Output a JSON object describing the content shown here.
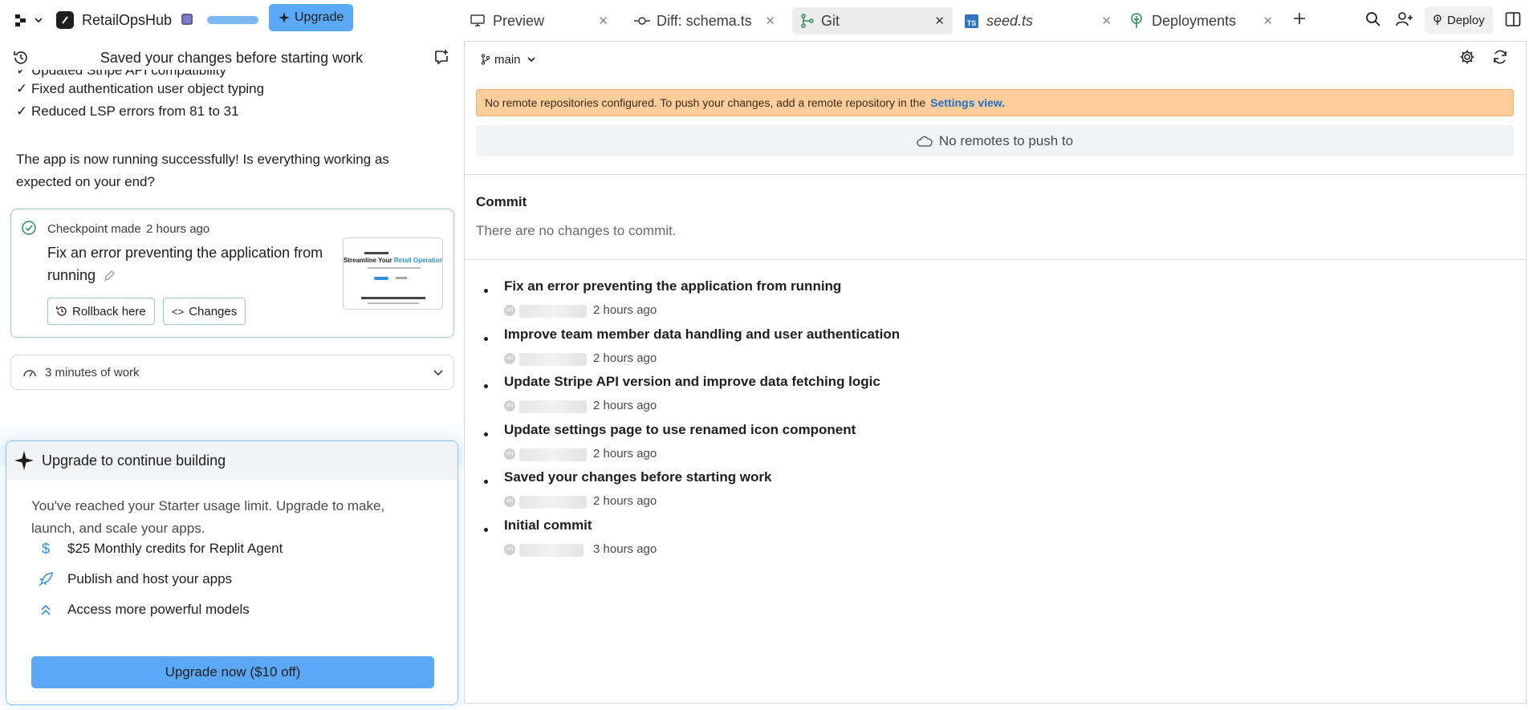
{
  "topbar": {
    "project_name": "RetailOpsHub",
    "upgrade_label": "Upgrade",
    "tabs": [
      {
        "label": "Preview"
      },
      {
        "label": "Diff: schema.ts"
      },
      {
        "label": "Git"
      },
      {
        "label": "seed.ts",
        "badge": "TS"
      },
      {
        "label": "Deployments"
      }
    ],
    "deploy_label": "Deploy"
  },
  "chat": {
    "header_title": "Saved your changes before starting work",
    "partial_line": "✓ Updated Stripe API compatibility",
    "lines": [
      "✓ Fixed authentication user object typing",
      "✓ Reduced LSP errors from 81 to 31"
    ],
    "message": "The app is now running successfully! Is everything working as expected on your end?",
    "checkpoint": {
      "label": "Checkpoint made",
      "time": "2 hours ago",
      "title": "Fix an error preventing the application from running",
      "rollback_label": "Rollback here",
      "changes_label": "Changes",
      "thumb_line1": "Streamline Your",
      "thumb_line2": "Retail Operations"
    },
    "work_label": "3 minutes of work"
  },
  "upgrade_card": {
    "title": "Upgrade to continue building",
    "description": "You've reached your Starter usage limit. Upgrade to make, launch, and scale your apps.",
    "features": [
      {
        "icon": "dollar-icon",
        "label": "$25 Monthly credits for Replit Agent"
      },
      {
        "icon": "rocket-icon",
        "label": "Publish and host your apps"
      },
      {
        "icon": "chevrons-up-icon",
        "label": "Access more powerful models"
      }
    ],
    "button_label": "Upgrade now ($10 off)"
  },
  "git": {
    "branch": "main",
    "warning_text": "No remote repositories configured. To push your changes, add a remote repository in the",
    "warning_link": "Settings view.",
    "no_remotes_label": "No remotes to push to",
    "commit_heading": "Commit",
    "no_changes_text": "There are no changes to commit.",
    "commits": [
      {
        "title": "Fix an error preventing the application from running",
        "avatar": "AN",
        "time": "2 hours ago"
      },
      {
        "title": "Improve team member data handling and user authentication",
        "avatar": "AN",
        "time": "2 hours ago"
      },
      {
        "title": "Update Stripe API version and improve data fetching logic",
        "avatar": "AN",
        "time": "2 hours ago"
      },
      {
        "title": "Update settings page to use renamed icon component",
        "avatar": "AN",
        "time": "2 hours ago"
      },
      {
        "title": "Saved your changes before starting work",
        "avatar": "AN",
        "time": "2 hours ago"
      },
      {
        "title": "Initial commit",
        "avatar": "AN",
        "time": "3 hours ago"
      }
    ]
  },
  "colors": {
    "accent_blue": "#5aa8f6",
    "warning_bg": "#ffcd9a",
    "link_blue": "#1f6fc5",
    "checkpoint_green": "#2e8b57"
  }
}
